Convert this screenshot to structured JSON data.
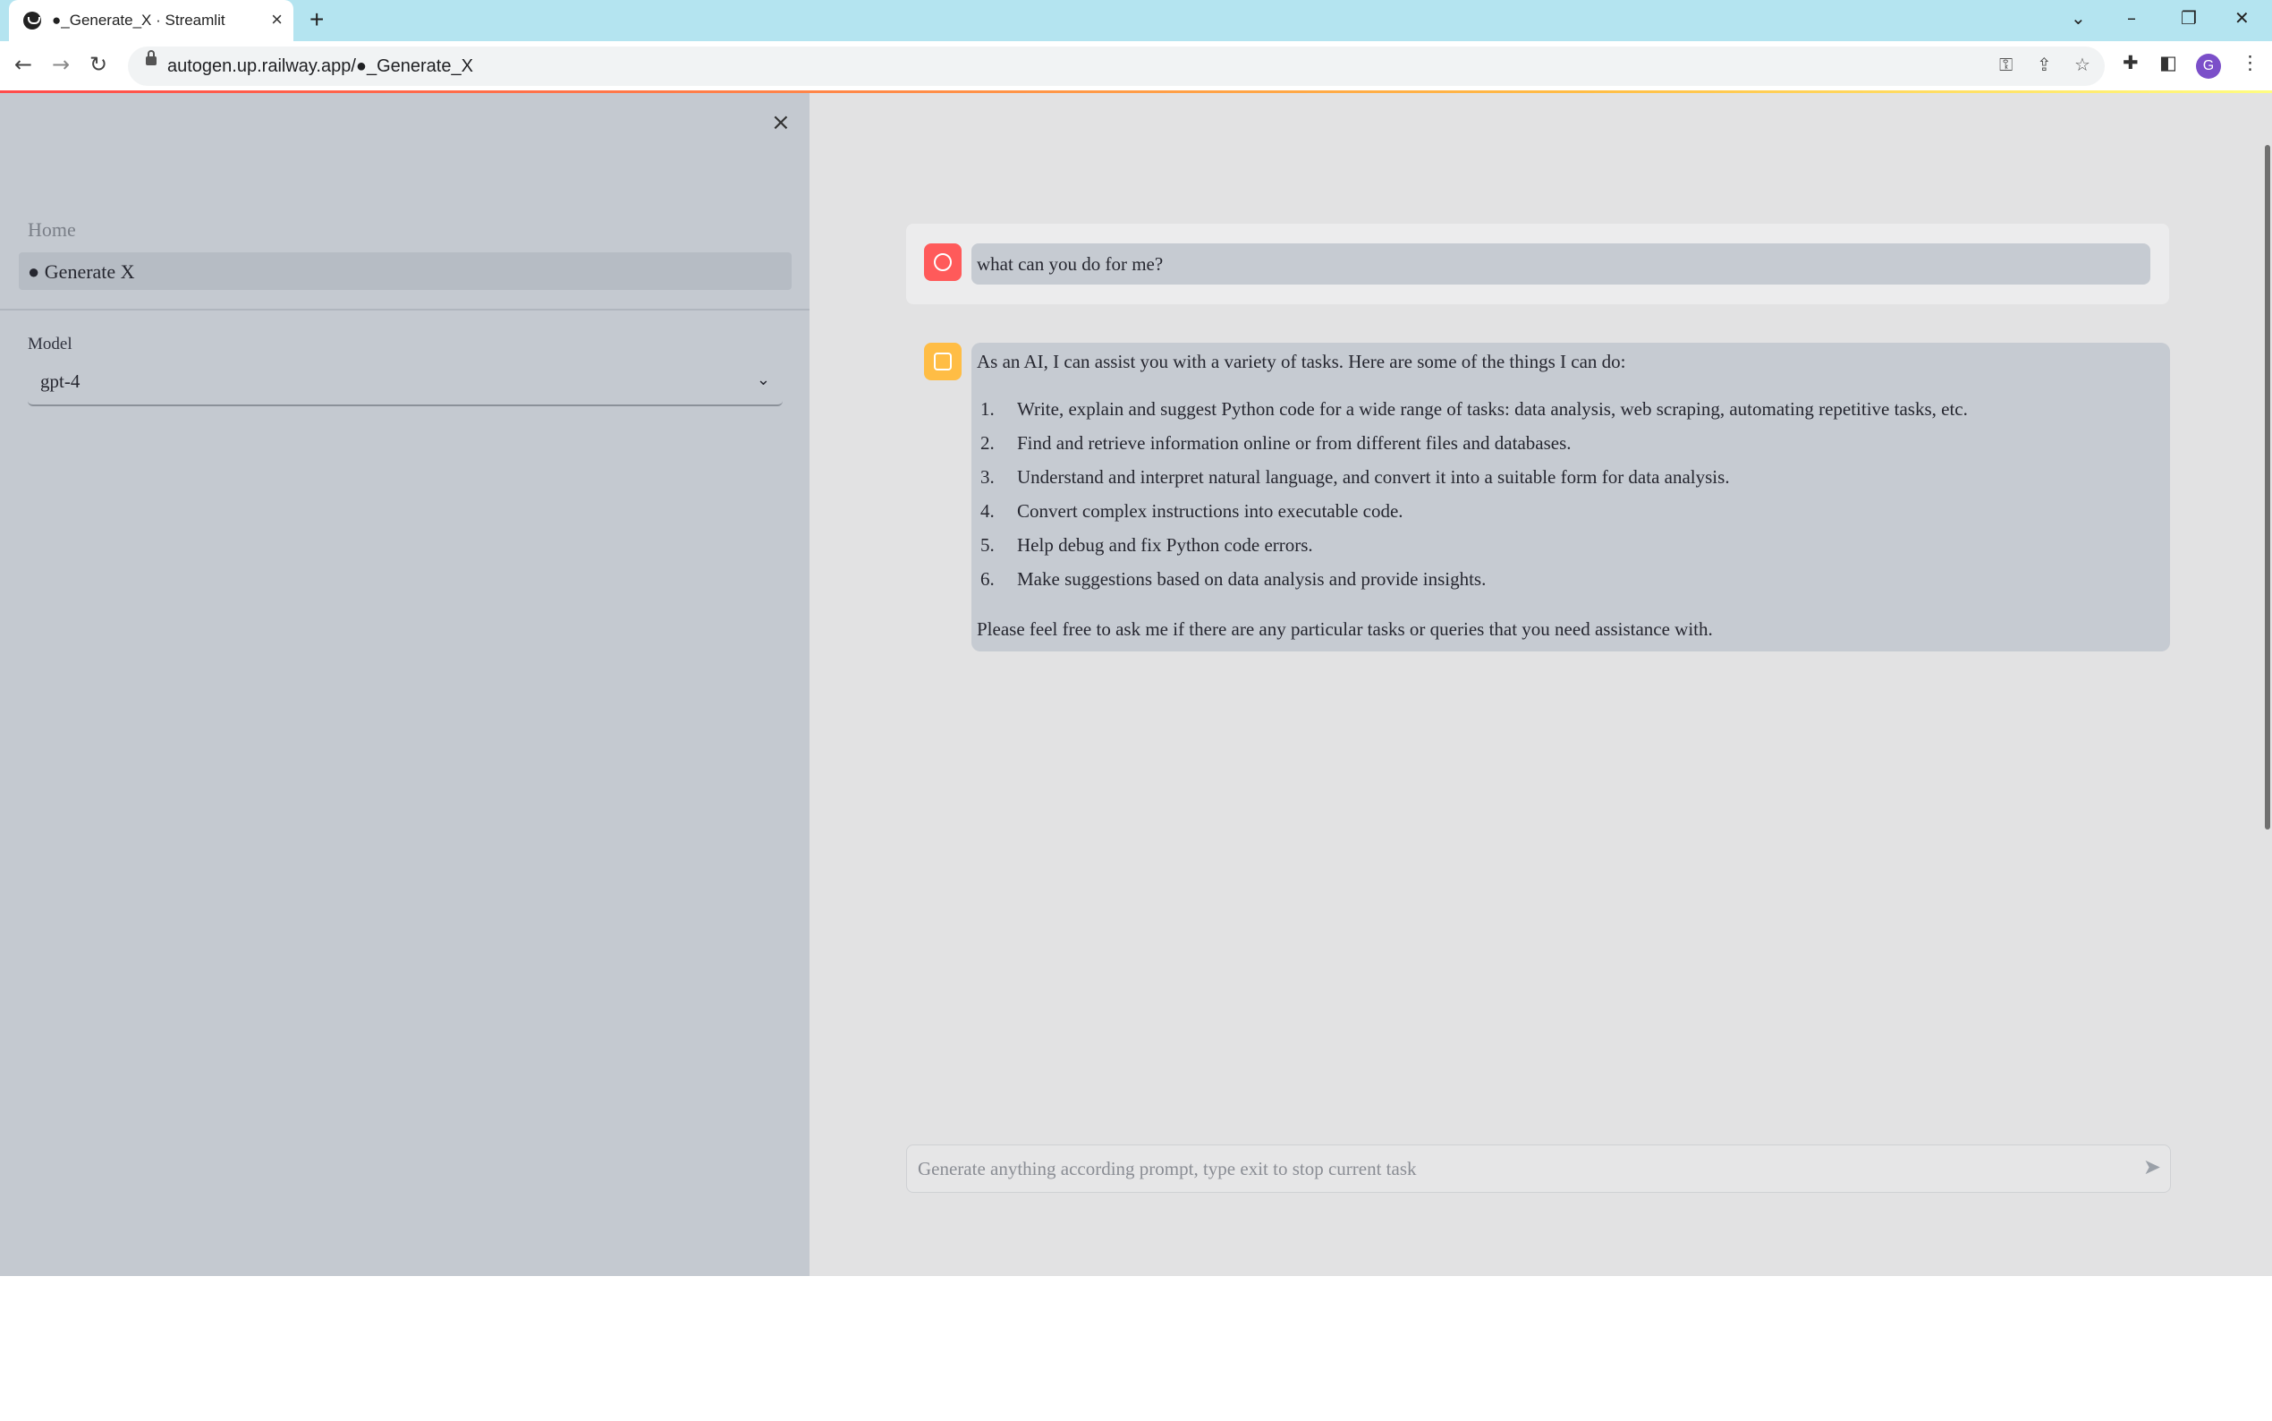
{
  "browser": {
    "tab_title": "●_Generate_X · Streamlit",
    "tab_close": "×",
    "new_tab": "+",
    "url": "autogen.up.railway.app/●_Generate_X",
    "profile_initial": "G",
    "controls": {
      "dropdown": "⌄",
      "minimize": "–",
      "restore": "❐",
      "close": "✕"
    },
    "icons": [
      "back-arrow-icon",
      "forward-arrow-icon",
      "reload-icon",
      "lock-icon",
      "key-icon",
      "share-icon",
      "star-icon",
      "extensions-icon",
      "side-panel-icon",
      "kebab-menu-icon"
    ]
  },
  "sidebar": {
    "close_label": "×",
    "nav": [
      {
        "label": "Home"
      },
      {
        "label": "● Generate X"
      }
    ],
    "model": {
      "label": "Model",
      "selected": "gpt-4"
    }
  },
  "chat": {
    "messages": [
      {
        "role": "user",
        "avatar_icon": "user-face-icon",
        "text": "what can you do for me?"
      },
      {
        "role": "assistant",
        "avatar_icon": "robot-icon",
        "intro": "As an AI, I can assist you with a variety of tasks. Here are some of the things I can do:",
        "items": [
          {
            "num": "1.",
            "text": "Write, explain and suggest Python code for a wide range of tasks: data analysis, web scraping, automating repetitive tasks, etc."
          },
          {
            "num": "2.",
            "text": "Find and retrieve information online or from different files and databases."
          },
          {
            "num": "3.",
            "text": "Understand and interpret natural language, and convert it into a suitable form for data analysis."
          },
          {
            "num": "4.",
            "text": "Convert complex instructions into executable code."
          },
          {
            "num": "5.",
            "text": "Help debug and fix Python code errors."
          },
          {
            "num": "6.",
            "text": "Make suggestions based on data analysis and provide insights."
          }
        ],
        "outro": "Please feel free to ask me if there are any particular tasks or queries that you need assistance with."
      }
    ],
    "input": {
      "placeholder": "Generate anything according prompt, type exit to stop current task",
      "value": ""
    }
  },
  "colors": {
    "sidebar_bg": "#c4c9d0",
    "main_bg": "#e2e2e3",
    "user_avatar": "#ff5a5a",
    "bot_avatar": "#ffbd45",
    "tabbar_bg": "#b4e4f0"
  }
}
